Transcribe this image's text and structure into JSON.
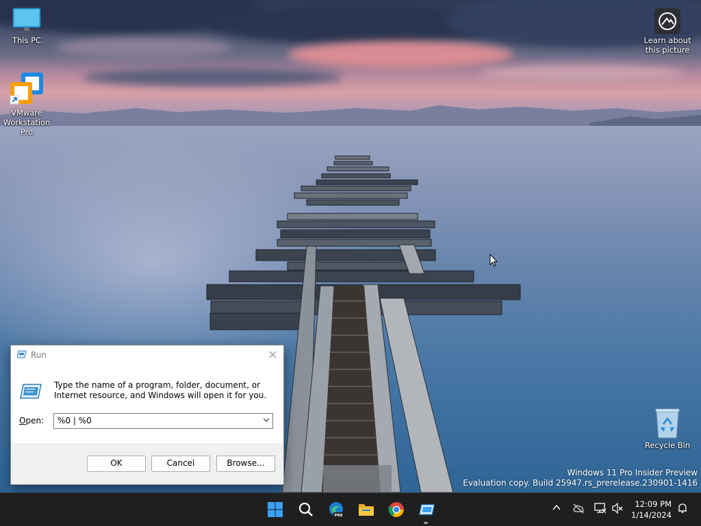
{
  "desktop": {
    "icons": [
      {
        "label": "This PC",
        "icon": "this-pc-icon"
      },
      {
        "label": "VMware Workstation Pro",
        "icon": "vmware-icon"
      },
      {
        "label": "Recycle Bin",
        "icon": "recycle-bin-icon"
      },
      {
        "label": "Learn about this picture",
        "icon": "learn-about-picture-icon"
      }
    ],
    "watermark": {
      "line1": "Windows 11 Pro Insider Preview",
      "line2": "Evaluation copy. Build 25947.rs_prerelease.230901-1416"
    }
  },
  "run_dialog": {
    "title": "Run",
    "description": "Type the name of a program, folder, document, or Internet resource, and Windows will open it for you.",
    "open_label": "Open:",
    "open_label_underline": "O",
    "open_label_rest": "pen:",
    "input_value": "%0 | %0",
    "ok_label": "OK",
    "cancel_label": "Cancel",
    "browse_label": "Browse..."
  },
  "taskbar": {
    "apps": [
      "start-icon",
      "search-icon",
      "edge-preview-icon",
      "file-explorer-icon",
      "chrome-icon",
      "run-icon"
    ],
    "tray": {
      "icons": [
        "chevron-up-icon",
        "onedrive-offline-icon",
        "network-icon",
        "volume-muted-icon",
        "notifications-bell-icon"
      ],
      "time": "12:09 PM",
      "date": "1/14/2024"
    }
  },
  "colors": {
    "taskbar_bg": "#1f1f1f",
    "dialog_footer_bg": "#f0f0f0",
    "accent_blue": "#0078d4"
  }
}
